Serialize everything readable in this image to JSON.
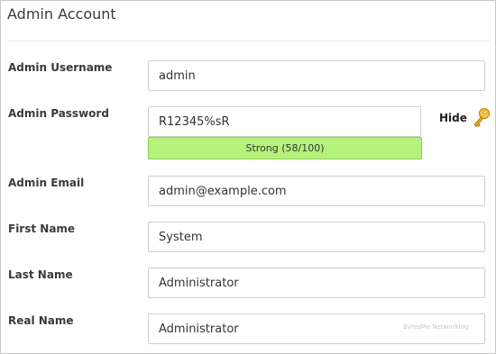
{
  "panel": {
    "title": "Admin Account"
  },
  "form": {
    "username": {
      "label": "Admin Username",
      "value": "admin"
    },
    "password": {
      "label": "Admin Password",
      "value": "R12345%sR",
      "strength_text": "Strong (58/100)",
      "strength_score": 58,
      "toggle_label": "Hide"
    },
    "email": {
      "label": "Admin Email",
      "value": "admin@example.com"
    },
    "first_name": {
      "label": "First Name",
      "value": "System"
    },
    "last_name": {
      "label": "Last Name",
      "value": "Administrator"
    },
    "real_name": {
      "label": "Real Name",
      "value": "Administrator"
    }
  },
  "watermark": "BytesMe Networking",
  "icons": {
    "toggle_icon": "key-icon"
  },
  "colors": {
    "strength_fill": "#b6f37c",
    "strength_border": "#8fca58",
    "key_gold": "#e5a929"
  }
}
